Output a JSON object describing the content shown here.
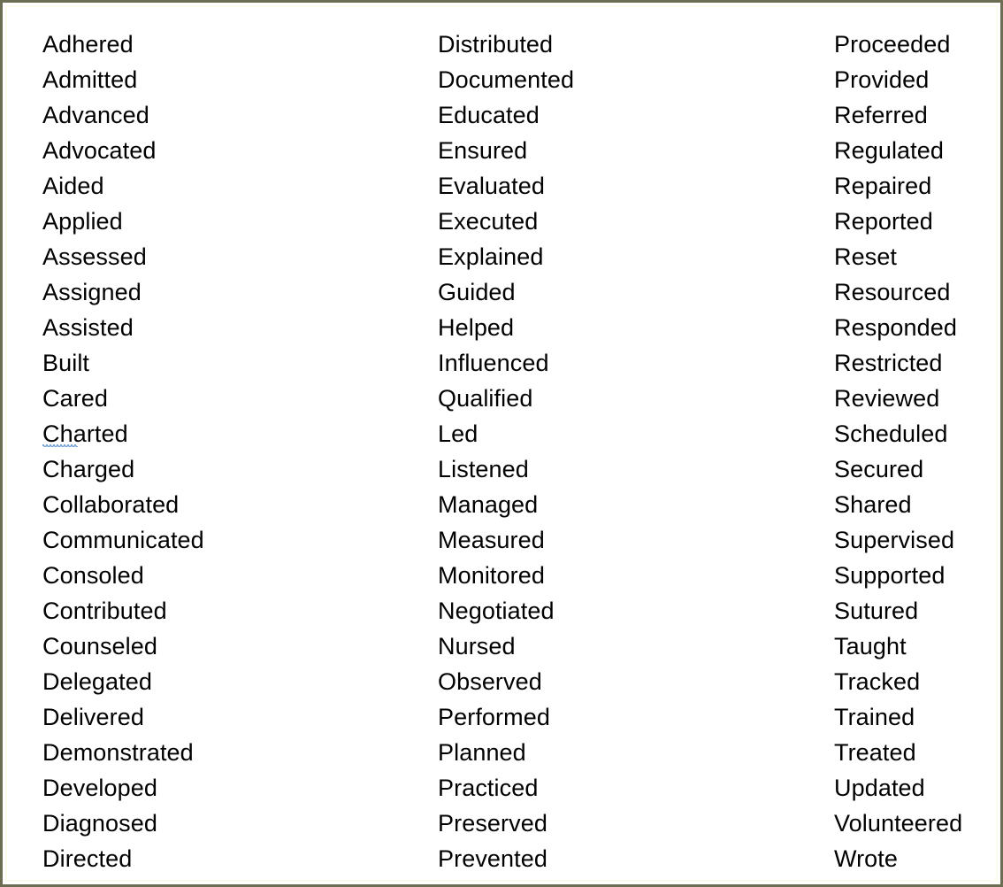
{
  "document": {
    "type": "action-verbs-list",
    "columns_count": 3,
    "border_color": "#6d6d53",
    "text_color": "#010101",
    "background_color": "#ffffff",
    "spellcheck_underline_color": "#4a86c8"
  },
  "columns": [
    {
      "name": "column-1",
      "items": [
        {
          "text": "Adhered",
          "misspelled": false
        },
        {
          "text": "Admitted",
          "misspelled": false
        },
        {
          "text": "Advanced",
          "misspelled": false
        },
        {
          "text": "Advocated",
          "misspelled": false
        },
        {
          "text": "Aided",
          "misspelled": false
        },
        {
          "text": "Applied",
          "misspelled": false
        },
        {
          "text": "Assessed",
          "misspelled": false
        },
        {
          "text": "Assigned",
          "misspelled": false
        },
        {
          "text": "Assisted",
          "misspelled": false
        },
        {
          "text": "Built",
          "misspelled": false
        },
        {
          "text": "Cared",
          "misspelled": false
        },
        {
          "text": "Charted",
          "misspelled": true
        },
        {
          "text": "Charged",
          "misspelled": false
        },
        {
          "text": "Collaborated",
          "misspelled": false
        },
        {
          "text": "Communicated",
          "misspelled": false
        },
        {
          "text": "Consoled",
          "misspelled": false
        },
        {
          "text": "Contributed",
          "misspelled": false
        },
        {
          "text": "Counseled",
          "misspelled": false
        },
        {
          "text": "Delegated",
          "misspelled": false
        },
        {
          "text": "Delivered",
          "misspelled": false
        },
        {
          "text": "Demonstrated",
          "misspelled": false
        },
        {
          "text": "Developed",
          "misspelled": false
        },
        {
          "text": "Diagnosed",
          "misspelled": false
        },
        {
          "text": "Directed",
          "misspelled": false
        }
      ]
    },
    {
      "name": "column-2",
      "items": [
        {
          "text": "Distributed",
          "misspelled": false
        },
        {
          "text": "Documented",
          "misspelled": false
        },
        {
          "text": "Educated",
          "misspelled": false
        },
        {
          "text": "Ensured",
          "misspelled": false
        },
        {
          "text": "Evaluated",
          "misspelled": false
        },
        {
          "text": "Executed",
          "misspelled": false
        },
        {
          "text": "Explained",
          "misspelled": false
        },
        {
          "text": "Guided",
          "misspelled": false
        },
        {
          "text": "Helped",
          "misspelled": false
        },
        {
          "text": "Influenced",
          "misspelled": false
        },
        {
          "text": "Qualified",
          "misspelled": false
        },
        {
          "text": "Led",
          "misspelled": false
        },
        {
          "text": "Listened",
          "misspelled": false
        },
        {
          "text": "Managed",
          "misspelled": false
        },
        {
          "text": "Measured",
          "misspelled": false
        },
        {
          "text": "Monitored",
          "misspelled": false
        },
        {
          "text": "Negotiated",
          "misspelled": false
        },
        {
          "text": "Nursed",
          "misspelled": false
        },
        {
          "text": "Observed",
          "misspelled": false
        },
        {
          "text": "Performed",
          "misspelled": false
        },
        {
          "text": "Planned",
          "misspelled": false
        },
        {
          "text": "Practiced",
          "misspelled": false
        },
        {
          "text": "Preserved",
          "misspelled": false
        },
        {
          "text": "Prevented",
          "misspelled": false
        }
      ]
    },
    {
      "name": "column-3",
      "items": [
        {
          "text": "Proceeded",
          "misspelled": false
        },
        {
          "text": "Provided",
          "misspelled": false
        },
        {
          "text": "Referred",
          "misspelled": false
        },
        {
          "text": "Regulated",
          "misspelled": false
        },
        {
          "text": "Repaired",
          "misspelled": false
        },
        {
          "text": "Reported",
          "misspelled": false
        },
        {
          "text": "Reset",
          "misspelled": false
        },
        {
          "text": "Resourced",
          "misspelled": false
        },
        {
          "text": "Responded",
          "misspelled": false
        },
        {
          "text": "Restricted",
          "misspelled": false
        },
        {
          "text": "Reviewed",
          "misspelled": false
        },
        {
          "text": "Scheduled",
          "misspelled": false
        },
        {
          "text": "Secured",
          "misspelled": false
        },
        {
          "text": "Shared",
          "misspelled": false
        },
        {
          "text": "Supervised",
          "misspelled": false
        },
        {
          "text": "Supported",
          "misspelled": false
        },
        {
          "text": "Sutured",
          "misspelled": false
        },
        {
          "text": "Taught",
          "misspelled": false
        },
        {
          "text": "Tracked",
          "misspelled": false
        },
        {
          "text": "Trained",
          "misspelled": false
        },
        {
          "text": "Treated",
          "misspelled": false
        },
        {
          "text": "Updated",
          "misspelled": false
        },
        {
          "text": "Volunteered",
          "misspelled": false
        },
        {
          "text": "Wrote",
          "misspelled": false
        }
      ]
    }
  ]
}
